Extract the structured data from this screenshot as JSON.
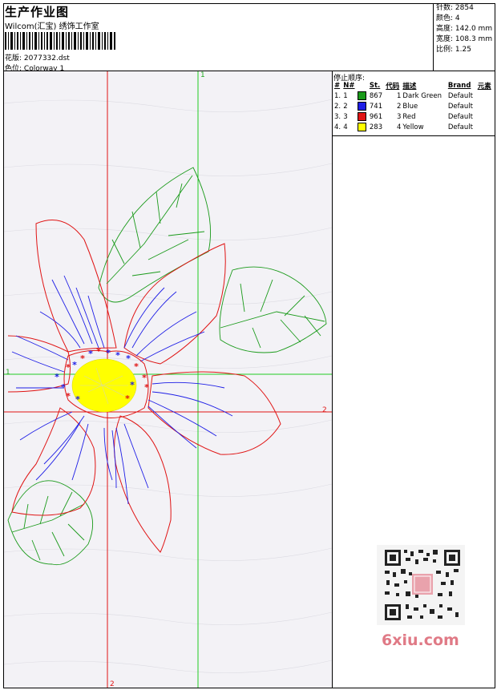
{
  "header": {
    "title": "生产作业图",
    "subtitle": "Wilcom(汇宝) 绣饰工作室",
    "file_label": "花版:",
    "file_value": "2077332.dst",
    "colorway_label": "色位:",
    "colorway_value": "Colorway 1"
  },
  "stats": [
    {
      "label": "针数:",
      "value": "2854"
    },
    {
      "label": "颜色:",
      "value": "4"
    },
    {
      "label": "高度:",
      "value": "142.0 mm"
    },
    {
      "label": "宽度:",
      "value": "108.3 mm"
    },
    {
      "label": "比例:",
      "value": "1.25"
    }
  ],
  "stop_sequence": {
    "heading": "停止顺序:",
    "columns": [
      "#",
      "N#",
      "St.",
      "代码",
      "描述",
      "Brand",
      "元素"
    ],
    "rows": [
      {
        "seq": "1.",
        "n": "1",
        "color": "#1a9a1a",
        "st": "867",
        "code": "1",
        "desc": "Dark Green",
        "brand": "Default"
      },
      {
        "seq": "2.",
        "n": "2",
        "color": "#1e1ee6",
        "st": "741",
        "code": "2",
        "desc": "Blue",
        "brand": "Default"
      },
      {
        "seq": "3.",
        "n": "3",
        "color": "#e01414",
        "st": "961",
        "code": "3",
        "desc": "Red",
        "brand": "Default"
      },
      {
        "seq": "4.",
        "n": "4",
        "color": "#ffff00",
        "st": "283",
        "code": "4",
        "desc": "Yellow",
        "brand": "Default"
      }
    ]
  },
  "axes": {
    "v1_label": "1",
    "h1_label": "1",
    "h2_label": "2",
    "v2_label": "2"
  },
  "watermark": "6xiu.com",
  "colors": {
    "green": "#1a9a1a",
    "blue": "#1e1ee6",
    "red": "#e01414",
    "yellow": "#ffff00",
    "guide_green": "#22cc22",
    "guide_red": "#e01414"
  }
}
